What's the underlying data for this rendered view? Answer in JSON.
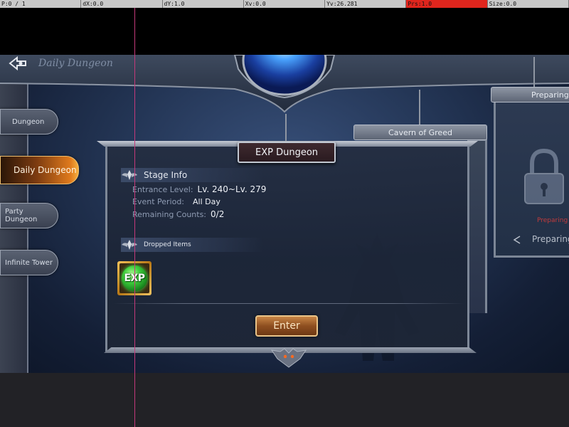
{
  "debug": {
    "pointer": "P:0 / 1",
    "dx": "dX:0.0",
    "dy": "dY:1.0",
    "xv": "Xv:0.0",
    "yv": "Yv:26.281",
    "prs": "Prs:1.0",
    "size": "Size:0.0"
  },
  "header": {
    "title": "Daily Dungeon",
    "back_icon": "back-arrow-icon"
  },
  "sidebar": {
    "items": [
      {
        "label": "Dungeon",
        "active": false
      },
      {
        "label": "Daily Dungeon",
        "active": true
      },
      {
        "label": "Party Dungeon",
        "active": false
      },
      {
        "label": "Infinite Tower",
        "active": false
      }
    ]
  },
  "side_panels": {
    "cavern_title": "Cavern of Greed",
    "preparing_title": "Preparing",
    "preparing_small": "Preparing",
    "preparing_large": "Preparing",
    "lock_icon": "lock-icon"
  },
  "main_panel": {
    "title": "EXP Dungeon",
    "stage_info": {
      "header": "Stage Info",
      "rows": [
        {
          "label": "Entrance Level:",
          "value": "Lv. 240~Lv. 279"
        },
        {
          "label": "Event Period:",
          "value": "All Day"
        },
        {
          "label": "Remaining Counts:",
          "value": "0/2"
        }
      ]
    },
    "dropped_items": {
      "header": "Dropped Items",
      "items": [
        {
          "label": "EXP",
          "icon": "exp-orb-icon"
        }
      ]
    },
    "enter_label": "Enter"
  },
  "colors": {
    "accent_orange": "#e07a1c",
    "panel_bg": "#242e42",
    "exp_green": "#3fcf3d",
    "debug_highlight": "#e0251d",
    "crosshair": "#c4397a"
  }
}
